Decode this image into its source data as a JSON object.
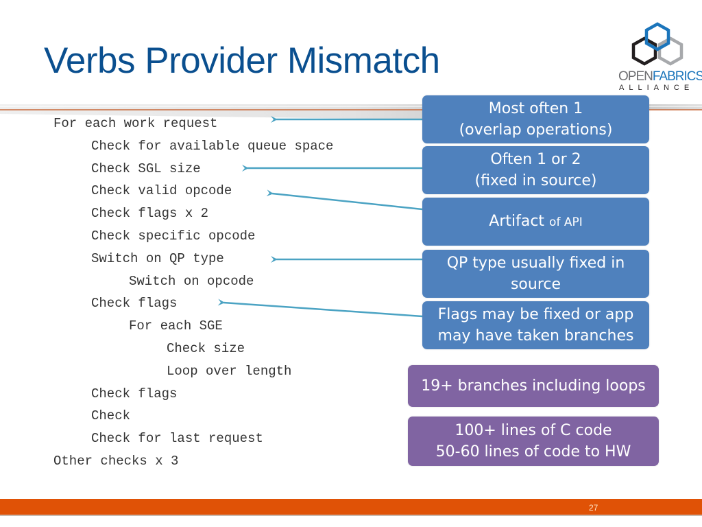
{
  "slide": {
    "title": "Verbs Provider Mismatch",
    "page_number": "27"
  },
  "logo": {
    "brand_part1": "OPEN",
    "brand_part2": "FABRICS",
    "subtitle": "ALLIANCE",
    "colors": {
      "hex_blue": "#1b75bb",
      "hex_black": "#231f20",
      "hex_gray": "#a7a9ac"
    }
  },
  "code": {
    "lines": [
      {
        "indent": 0,
        "text": "For each work request"
      },
      {
        "indent": 1,
        "text": "Check for available queue space"
      },
      {
        "indent": 1,
        "text": "Check SGL size"
      },
      {
        "indent": 1,
        "text": "Check valid opcode"
      },
      {
        "indent": 1,
        "text": "Check flags x 2"
      },
      {
        "indent": 1,
        "text": "Check specific opcode"
      },
      {
        "indent": 1,
        "text": "Switch on QP type"
      },
      {
        "indent": 2,
        "text": "Switch on opcode"
      },
      {
        "indent": 1,
        "text": "Check flags"
      },
      {
        "indent": 2,
        "text": "For each SGE"
      },
      {
        "indent": 3,
        "text": "Check size"
      },
      {
        "indent": 3,
        "text": "Loop over length"
      },
      {
        "indent": 1,
        "text": "Check flags"
      },
      {
        "indent": 1,
        "text": "Check"
      },
      {
        "indent": 1,
        "text": "Check for last request"
      },
      {
        "indent": 0,
        "text": "Other checks x 3"
      }
    ]
  },
  "callouts": [
    {
      "line1": "Most often 1",
      "line2": "(overlap operations)",
      "points_to_line": 0
    },
    {
      "line1": "Often 1 or 2",
      "line2": "(fixed in source)",
      "points_to_line": 2
    },
    {
      "main": "Artifact",
      "small": "of API",
      "points_to_line": 3
    },
    {
      "line1": "QP type usually fixed in",
      "line2": "source",
      "points_to_line": 6
    },
    {
      "line1": "Flags may be fixed or app",
      "line2": "may have taken branches",
      "points_to_line": 8
    }
  ],
  "summary": [
    {
      "line1": "19+ branches including loops"
    },
    {
      "line1": "100+ lines of C code",
      "line2": "50-60 lines of code to HW"
    }
  ],
  "colors": {
    "title": "#0a4f8f",
    "callout_blue": "#4f81bd",
    "summary_purple": "#8064a2",
    "arrow": "#4ba3c3",
    "footer_orange": "#e05206"
  }
}
